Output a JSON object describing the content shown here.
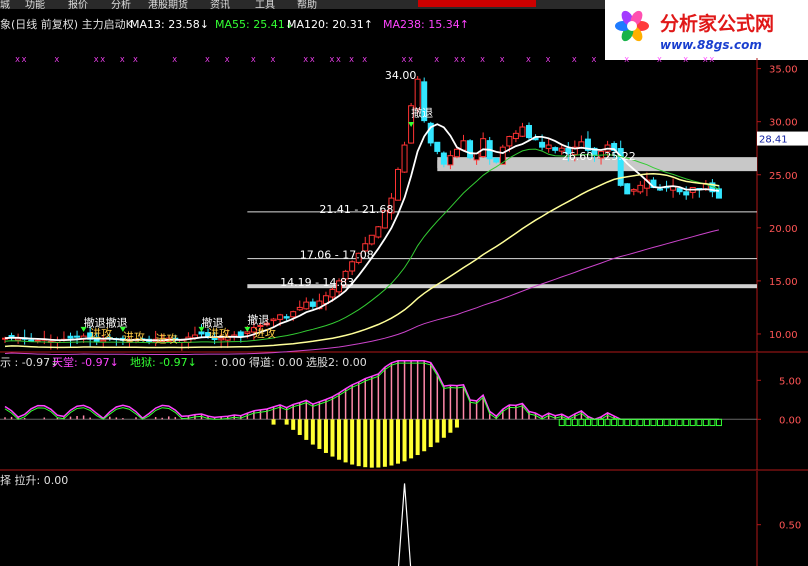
{
  "menu": [
    "城",
    "功能",
    "报价",
    "分析",
    "港股期货",
    "资讯",
    "工具",
    "帮助"
  ],
  "menu_colors": {
    "bg": "#2a2a2a",
    "text": "#ddd",
    "highlight": "#cc0000"
  },
  "logo": {
    "brand": "分析家公式网",
    "url": "www.88gs.com"
  },
  "main_panel": {
    "header": [
      {
        "text": "象(日线 前复权) 主力启动K",
        "color": "#e0e0e0"
      },
      {
        "text": "MA13: 23.58↓",
        "color": "#ffffff"
      },
      {
        "text": "MA55: 25.41↓",
        "color": "#33ff33"
      },
      {
        "text": "MA120: 20.31↑",
        "color": "#ffffff"
      },
      {
        "text": "MA238: 15.34↑",
        "color": "#ff44ff"
      }
    ],
    "price_tag": "28.41",
    "annotations": [
      {
        "text": "34.00",
        "x": 18,
        "y": 34.0
      },
      {
        "text": "撤退",
        "x": 22,
        "y": 30.5
      },
      {
        "text": "26.60 - 25.22",
        "x": 45,
        "y": 26.4
      },
      {
        "text": "21.41 - 21.68",
        "x": 8,
        "y": 21.4
      },
      {
        "text": "17.06 - 17.08",
        "x": 5,
        "y": 17.1
      },
      {
        "text": "14.19 - 14.83",
        "x": 2,
        "y": 14.5
      },
      {
        "text": "撤退撤退",
        "x": -28,
        "y": 10.7
      },
      {
        "text": "进攻",
        "x": -27,
        "y": 9.7
      },
      {
        "text": "进攻",
        "x": -22,
        "y": 9.4
      },
      {
        "text": "进攻",
        "x": -17,
        "y": 9.2
      },
      {
        "text": "撤退",
        "x": -10,
        "y": 10.7
      },
      {
        "text": "进攻",
        "x": -9,
        "y": 9.7
      },
      {
        "text": "撤退",
        "x": -3,
        "y": 11.0
      },
      {
        "text": "进攻",
        "x": -2,
        "y": 9.7
      }
    ]
  },
  "sub_panel": {
    "header": [
      {
        "text": "示 : -0.97↓",
        "color": "#e0e0e0"
      },
      {
        "text": "天堂: -0.97↓",
        "color": "#ff44ff"
      },
      {
        "text": "地狱: -0.97↓",
        "color": "#33ff33"
      },
      {
        "text": ": 0.00",
        "color": "#e0e0e0"
      },
      {
        "text": "得道: 0.00",
        "color": "#e0e0e0"
      },
      {
        "text": "选股2: 0.00",
        "color": "#e0e0e0"
      }
    ]
  },
  "bottom_panel": {
    "header": [
      {
        "text": "择 拉升: 0.00",
        "color": "#e0e0e0"
      }
    ]
  },
  "chart_data": [
    {
      "type": "candlestick",
      "title": "主力启动K",
      "yticks": [
        10.0,
        15.0,
        20.0,
        25.0,
        30.0,
        35.0
      ],
      "ylim": [
        8.3,
        36.0
      ],
      "grid": false,
      "x": [
        -40,
        -39,
        -38,
        -37,
        -36,
        -35,
        -34,
        -33,
        -32,
        -31,
        -30,
        -29,
        -28,
        -27,
        -26,
        -25,
        -24,
        -23,
        -22,
        -21,
        -20,
        -19,
        -18,
        -17,
        -16,
        -15,
        -14,
        -13,
        -12,
        -11,
        -10,
        -9,
        -8,
        -7,
        -6,
        -5,
        -4,
        -3,
        -2,
        -1,
        0,
        1,
        2,
        3,
        4,
        5,
        6,
        7,
        8,
        9,
        10,
        11,
        12,
        13,
        14,
        15,
        16,
        17,
        18,
        19,
        20,
        21,
        22,
        23,
        24,
        25,
        26,
        27,
        28,
        29,
        30,
        31,
        32,
        33,
        34,
        35,
        36,
        37,
        38,
        39,
        40,
        41,
        42,
        43,
        44,
        45,
        46,
        47,
        48,
        49,
        50,
        51,
        52,
        53,
        54,
        55,
        56,
        57,
        58,
        59,
        60,
        61,
        62,
        63,
        64,
        65,
        66,
        67,
        68,
        69
      ],
      "series": [
        {
          "name": "close",
          "values": [
            9.6,
            9.7,
            9.6,
            9.5,
            9.4,
            9.4,
            9.5,
            9.3,
            9.4,
            9.5,
            9.6,
            9.7,
            9.8,
            9.5,
            9.3,
            9.4,
            9.6,
            9.5,
            9.4,
            9.3,
            9.5,
            9.4,
            9.3,
            9.5,
            9.4,
            9.6,
            9.5,
            9.4,
            9.7,
            9.9,
            10.0,
            9.7,
            9.5,
            9.6,
            9.7,
            9.9,
            9.8,
            10.2,
            10.6,
            10.8,
            11.0,
            11.4,
            11.8,
            11.5,
            12.1,
            12.5,
            13.0,
            12.6,
            13.1,
            13.6,
            14.2,
            15.0,
            15.9,
            16.8,
            17.6,
            18.5,
            19.3,
            20.1,
            21.6,
            22.8,
            25.5,
            27.8,
            31.5,
            34.0,
            30.1,
            28.0,
            27.2,
            26.0,
            26.8,
            27.4,
            28.2,
            26.6,
            27.0,
            28.4,
            26.5,
            26.2,
            27.6,
            28.6,
            28.9,
            29.5,
            28.5,
            28.3,
            27.6,
            27.8,
            27.3,
            27.5,
            27.0,
            27.6,
            28.1,
            27.3,
            26.8,
            27.2,
            27.8,
            27.3,
            24.0,
            23.2,
            23.6,
            24.0,
            24.5,
            23.8,
            23.6,
            23.8,
            23.9,
            23.4,
            23.1,
            23.8,
            23.6,
            24.1,
            23.4,
            22.8
          ]
        }
      ]
    },
    {
      "type": "bar",
      "title": "",
      "yticks": [
        0.0,
        5.0
      ],
      "ylim": [
        -6.5,
        8.5
      ],
      "series": [
        {
          "name": "天堂",
          "color": "#ff44ff"
        },
        {
          "name": "地狱",
          "color": "#33ff33"
        }
      ]
    },
    {
      "type": "line",
      "title": "拉升",
      "yticks": [
        0.5
      ],
      "ylim": [
        0,
        1.15
      ],
      "series": [
        {
          "name": "拉升",
          "peak_at": 21,
          "peak": 1.0
        }
      ]
    }
  ]
}
